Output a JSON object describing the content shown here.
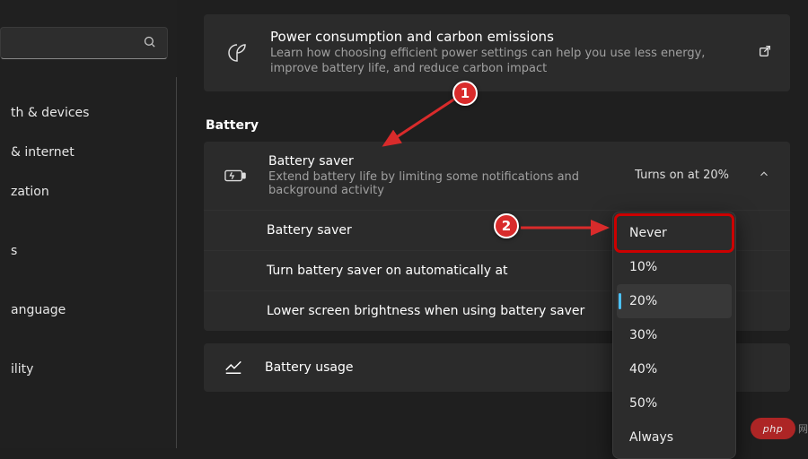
{
  "sidebar": {
    "items": [
      {
        "label": "th & devices"
      },
      {
        "label": "& internet"
      },
      {
        "label": "zation"
      },
      {
        "label": "s"
      },
      {
        "label": "anguage"
      },
      {
        "label": "ility"
      }
    ]
  },
  "power_card": {
    "title": "Power consumption and carbon emissions",
    "desc": "Learn how choosing efficient power settings can help you use less energy, improve battery life, and reduce carbon impact"
  },
  "section_header": "Battery",
  "saver": {
    "title": "Battery saver",
    "desc": "Extend battery life by limiting some notifications and background activity",
    "right": "Turns on at 20%"
  },
  "subrows": {
    "r1": "Battery saver",
    "r2": "Turn battery saver on automatically at",
    "r3": "Lower screen brightness when using battery saver"
  },
  "usage": {
    "title": "Battery usage"
  },
  "dropdown": {
    "options": [
      "Never",
      "10%",
      "20%",
      "30%",
      "40%",
      "50%",
      "Always"
    ],
    "selected_index": 2,
    "boxed_index": 0
  },
  "annotations": {
    "b1": "1",
    "b2": "2"
  },
  "watermark": "php",
  "watermark_txt": "网"
}
